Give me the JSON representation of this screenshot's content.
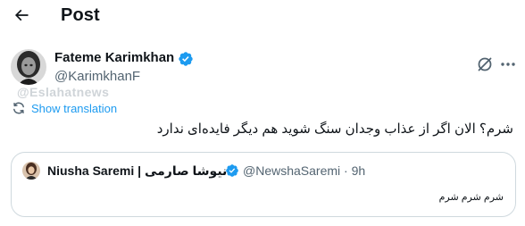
{
  "header": {
    "title": "Post"
  },
  "post": {
    "author": {
      "display_name": "Fateme Karimkhan",
      "handle": "@KarimkhanF",
      "verified": true
    },
    "watermark": "@Eslahatnews",
    "translate_label": "Show translation",
    "text": "شرم؟ الان اگر از عذاب وجدان سنگ شوید هم دیگر فایده‌ای ندارد"
  },
  "quote": {
    "display_name": "Niusha Saremi | نیوشا صارمی",
    "verified": true,
    "handle": "@NewshaSaremi",
    "separator": "·",
    "time": "9h",
    "text": "شرم شرم شرم"
  },
  "colors": {
    "accent": "#1d9bf0",
    "secondary_text": "#536471",
    "border": "#cfd9de"
  },
  "icons": {
    "back": "arrow-left-icon",
    "verified": "verified-badge-icon",
    "grok": "grok-icon",
    "more": "more-horizontal-icon",
    "translate": "translate-icon"
  }
}
